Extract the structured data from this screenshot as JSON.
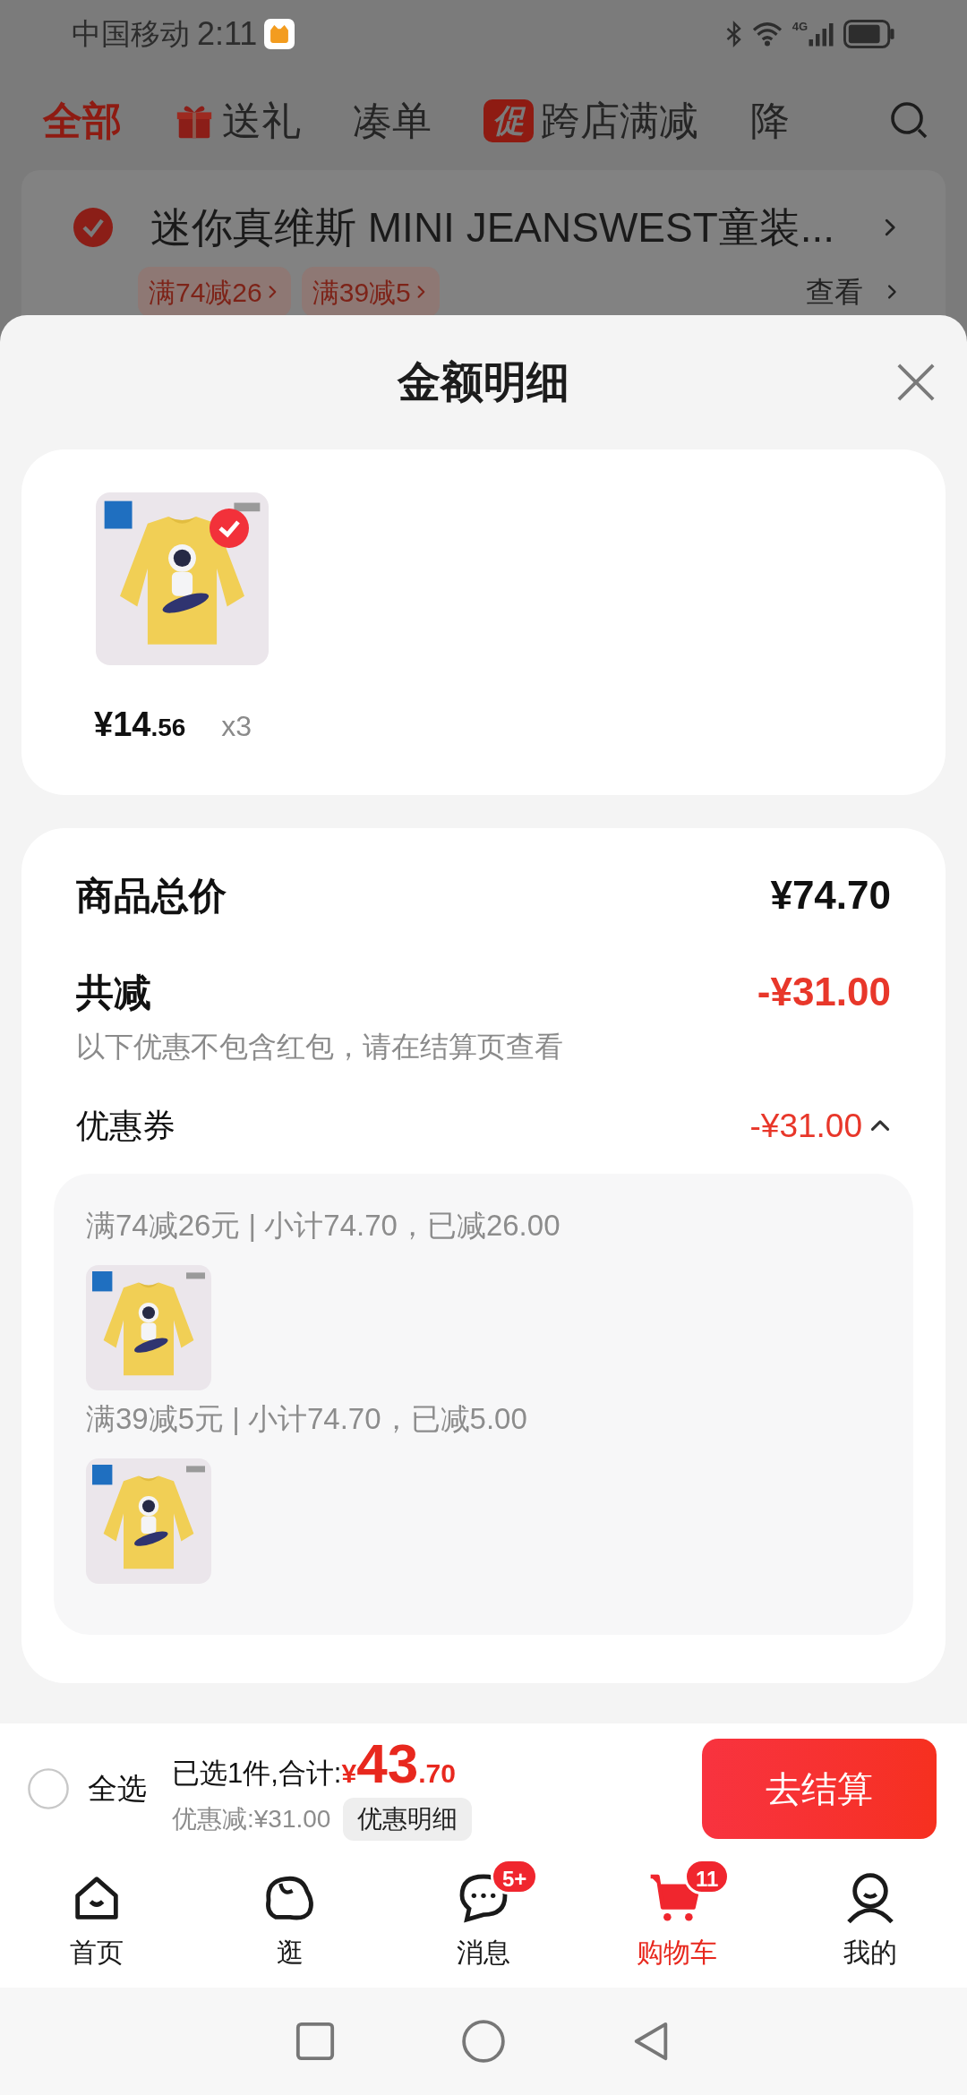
{
  "status_bar": {
    "carrier": "中国移动",
    "time": "2:11",
    "network": "4G"
  },
  "category_tabs": [
    {
      "label": "全部",
      "selected": true,
      "kind": "plain"
    },
    {
      "label": "送礼",
      "selected": false,
      "kind": "gift"
    },
    {
      "label": "凑单",
      "selected": false,
      "kind": "plain"
    },
    {
      "label": "跨店满减",
      "selected": false,
      "kind": "promo",
      "badge": "促"
    },
    {
      "label": "降",
      "selected": false,
      "kind": "plain"
    }
  ],
  "store": {
    "name": "迷你真维斯 MINI JEANSWEST童装...",
    "checked": true,
    "tags": [
      "满74减26",
      "满39减5"
    ],
    "view_link": "查看"
  },
  "sheet": {
    "title": "金额明细",
    "product": {
      "kind": "picture",
      "selected": true,
      "price_main": "¥14",
      "price_decimal": ".56",
      "quantity": "x3"
    },
    "summary": {
      "total_label": "商品总价",
      "total": "¥74.70",
      "discount_label": "共减",
      "discount": "-¥31.00",
      "note": "以下优惠不包含红包，请在结算页查看"
    },
    "coupons": {
      "label": "优惠券",
      "amount": "-¥31.00",
      "expanded": true,
      "items": [
        {
          "text": "满74减26元 | 小计74.70，已减26.00",
          "kind": "picture"
        },
        {
          "text": "满39减5元 | 小计74.70，已减5.00",
          "kind": "picture"
        }
      ]
    }
  },
  "checkout_bar": {
    "select_all": {
      "label": "全选",
      "checked": false
    },
    "selected_text": "已选1件,合计:",
    "currency": "¥",
    "total_main": "43",
    "total_decimal": ".70",
    "discount_text": "优惠减:¥31.00",
    "detail_button": "优惠明细",
    "checkout_button": "去结算"
  },
  "bottom_nav": [
    {
      "label": "首页",
      "kind": "home",
      "selected": false
    },
    {
      "label": "逛",
      "kind": "browse",
      "selected": false
    },
    {
      "label": "消息",
      "kind": "chat",
      "selected": false,
      "badge": "5+"
    },
    {
      "label": "购物车",
      "kind": "cart",
      "selected": true,
      "badge": "11"
    },
    {
      "label": "我的",
      "kind": "person",
      "selected": false
    }
  ]
}
